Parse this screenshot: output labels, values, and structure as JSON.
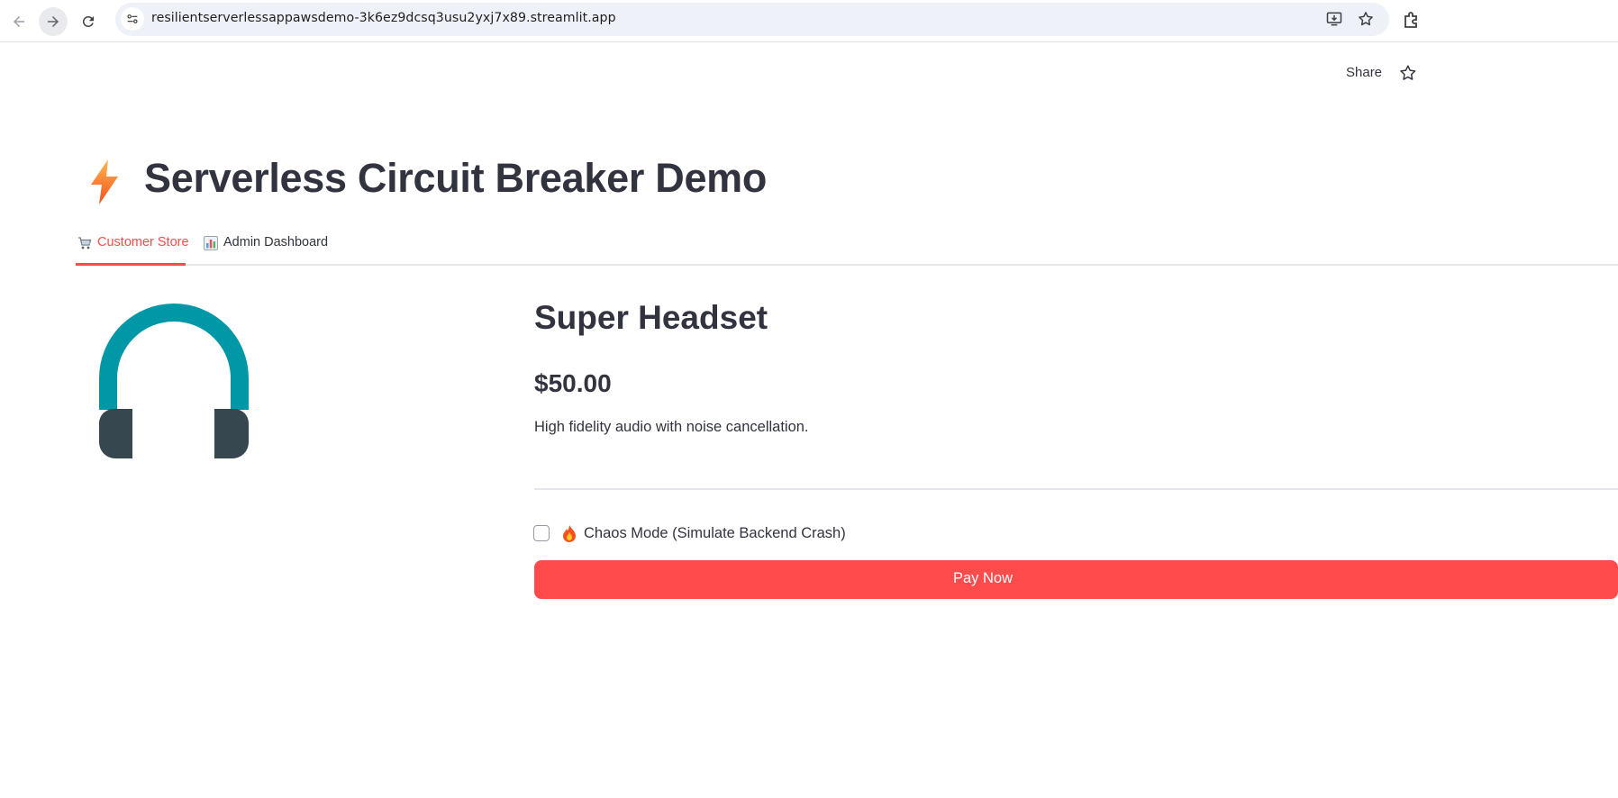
{
  "browser": {
    "url": "resilientserverlessappawsdemo-3k6ez9dcsq3usu2yxj7x89.streamlit.app"
  },
  "header": {
    "share_label": "Share"
  },
  "app": {
    "title": "Serverless Circuit Breaker Demo",
    "title_icon": "lightning-icon"
  },
  "tabs": [
    {
      "label": "Customer Store",
      "icon": "shopping-cart-icon",
      "active": true
    },
    {
      "label": "Admin Dashboard",
      "icon": "bar-chart-icon",
      "active": false
    }
  ],
  "product": {
    "name": "Super Headset",
    "price": "$50.00",
    "description": "High fidelity audio with noise cancellation.",
    "image_icon": "headphones-icon"
  },
  "chaos": {
    "label": "Chaos Mode (Simulate Backend Crash)",
    "icon": "fire-icon",
    "checked": false
  },
  "pay_button": {
    "label": "Pay Now"
  },
  "colors": {
    "accent": "#ff4b4b",
    "text": "#31333f",
    "headset_band": "#0097a7",
    "headset_cups": "#37474f"
  }
}
